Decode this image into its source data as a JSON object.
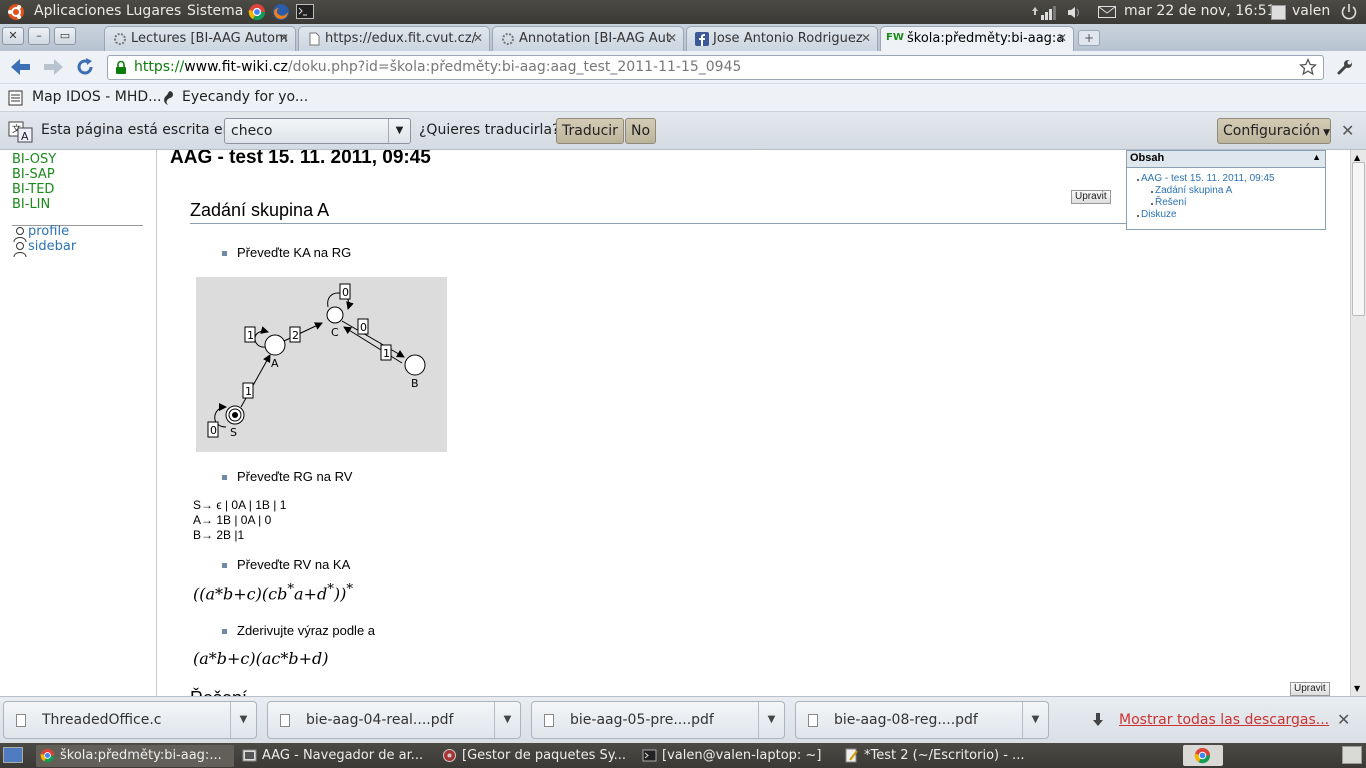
{
  "panel": {
    "menus": [
      "Aplicaciones",
      "Lugares",
      "Sistema"
    ],
    "datetime": "mar 22 de nov, 16:51",
    "user": "valen"
  },
  "tabs": [
    {
      "label": "Lectures [BI-AAG Autom"
    },
    {
      "label": "https://edux.fit.cvut.cz/"
    },
    {
      "label": "Annotation [BI-AAG Aut"
    },
    {
      "label": "Jose Antonio Rodriguez"
    },
    {
      "label": "škola:předměty:bi-aag:a",
      "icon_text": "FW"
    }
  ],
  "address": {
    "scheme": "https://",
    "host": "www.fit-wiki.cz",
    "path": "/doku.php?id=škola:předměty:bi-aag:aag_test_2011-11-15_0945"
  },
  "bookmarks": [
    "Map IDOS - MHD...",
    "Eyecandy for yo..."
  ],
  "translate": {
    "prefix": "Esta página está escrita en",
    "language": "checo",
    "question": "¿Quieres traducirla?",
    "translate_btn": "Traducir",
    "no_btn": "No",
    "config_btn": "Configuración"
  },
  "sidebar": {
    "links": [
      "BI-OSY",
      "BI-SAP",
      "BI-TED",
      "BI-LIN"
    ],
    "user_links": [
      "profile",
      "sidebar"
    ]
  },
  "content": {
    "title": "AAG - test 15. 11. 2011, 09:45",
    "section": "Zadání skupina A",
    "edit_label": "Upravit",
    "bullet1": "Převeďte KA na RG",
    "bullet2": "Převeďte RG na RV",
    "grammar": [
      "S→ ϵ | 0A | 1B | 1",
      "A→ 1B | 0A | 0",
      "B→ 2B |1"
    ],
    "bullet3": "Převeďte RV na KA",
    "bullet4": "Zderivujte výraz podle a",
    "next_heading": "Řešení"
  },
  "automaton": {
    "states": [
      "S",
      "A",
      "C",
      "B"
    ],
    "edge_labels": [
      "0",
      "1",
      "1",
      "2",
      "0",
      "0",
      "1"
    ]
  },
  "toc": {
    "title": "Obsah",
    "items": [
      "AAG - test 15. 11. 2011, 09:45",
      "Zadání skupina A",
      "Řešení",
      "Diskuze"
    ]
  },
  "downloads": {
    "items": [
      "ThreadedOffice.c",
      "bie-aag-04-real....pdf",
      "bie-aag-05-pre....pdf",
      "bie-aag-08-reg....pdf"
    ],
    "show_all": "Mostrar todas las descargas..."
  },
  "taskbar": {
    "items": [
      "škola:předměty:bi-aag:...",
      "AAG - Navegador de ar...",
      "[Gestor de paquetes Sy...",
      "[valen@valen-laptop: ~]",
      "*Test 2 (~/Escritorio) - ..."
    ]
  }
}
